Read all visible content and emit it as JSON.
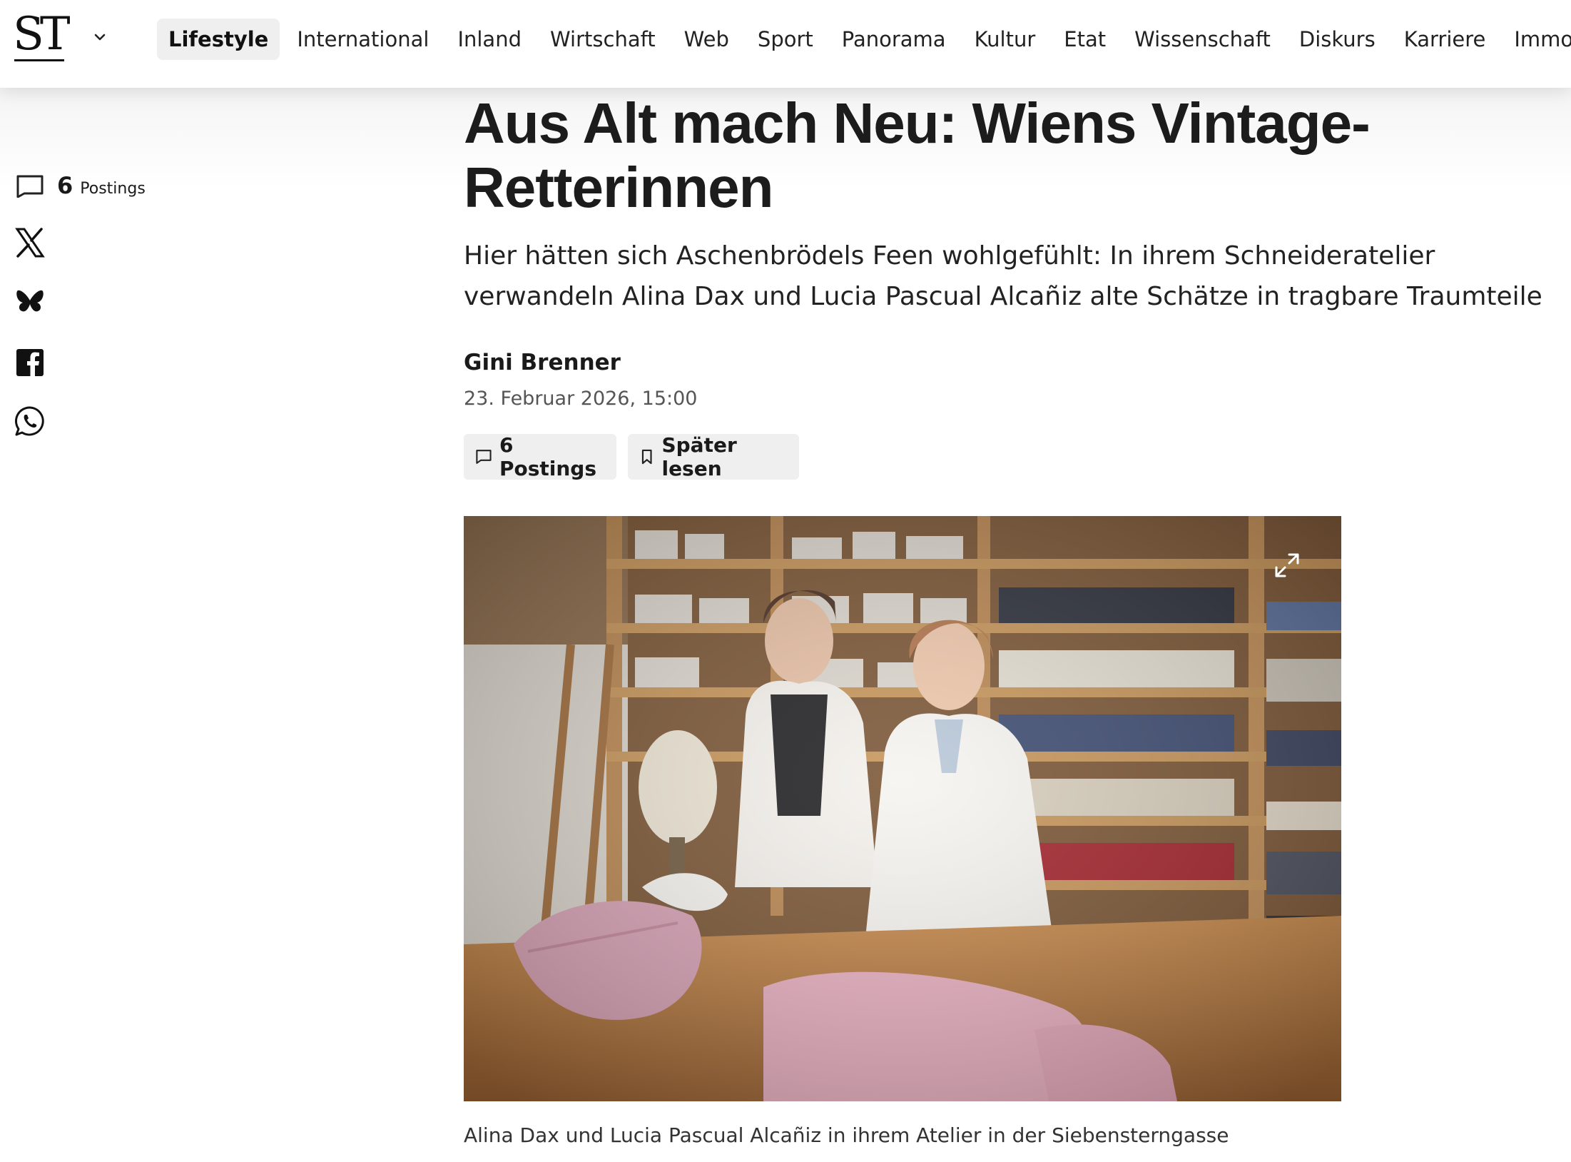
{
  "header": {
    "logo": "ST",
    "nav": [
      "Lifestyle",
      "International",
      "Inland",
      "Wirtschaft",
      "Web",
      "Sport",
      "Panorama",
      "Kultur",
      "Etat",
      "Wissenschaft",
      "Diskurs",
      "Karriere",
      "Immobilien"
    ],
    "active_nav": "Lifestyle"
  },
  "share_rail": {
    "postings_count": "6",
    "postings_label": "Postings",
    "icons": [
      "comment-icon",
      "x-icon",
      "bluesky-icon",
      "facebook-icon",
      "whatsapp-icon"
    ]
  },
  "article": {
    "headline": "Aus Alt mach Neu: Wiens Vintage-Retterinnen",
    "lead": "Hier hätten sich Aschenbrödels Feen wohlgefühlt: In ihrem Schneideratelier verwandeln Alina Dax und Lucia Pascual Alcañiz alte Schätze in tragbare Traumteile",
    "author": "Gini Brenner",
    "date": "23. Februar 2026, 15:00",
    "buttons": {
      "postings": "6 Postings",
      "read_later": "Später lesen"
    },
    "image_caption": "Alina Dax und Lucia Pascual Alcañiz in ihrem Atelier in der Siebensterngasse"
  },
  "colors": {
    "active_nav_bg": "#efefef",
    "button_bg": "#efefef",
    "text": "#1a1a1a"
  }
}
